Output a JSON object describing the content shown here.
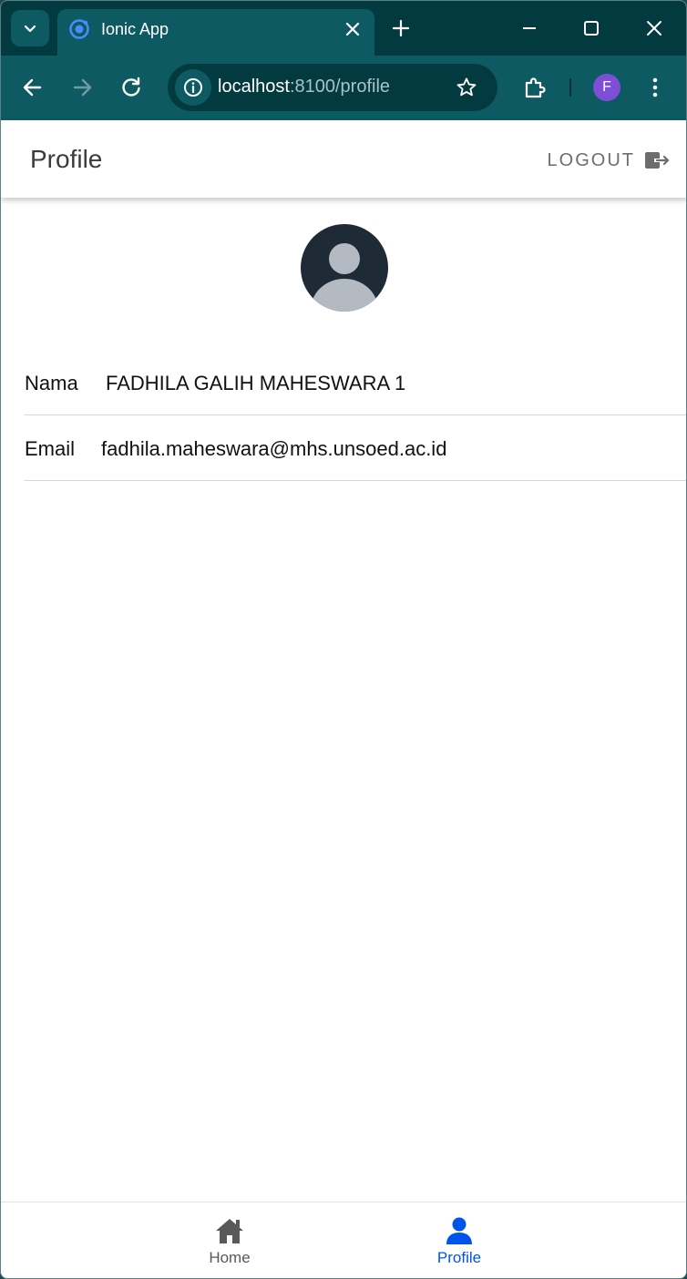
{
  "browser": {
    "tab_title": "Ionic App",
    "url_host": "localhost",
    "url_rest": ":8100/profile",
    "profile_initial": "F",
    "colors": {
      "frame": "#033a40",
      "toolbar": "#0d5a63",
      "profile": "#7e4fd6"
    }
  },
  "header": {
    "title": "Profile",
    "logout_label": "LOGOUT"
  },
  "profile": {
    "fields": [
      {
        "label": "Nama",
        "value": "FADHILA GALIH MAHESWARA 1"
      },
      {
        "label": "Email",
        "value": "fadhila.maheswara@mhs.unsoed.ac.id"
      }
    ]
  },
  "tabs": [
    {
      "label": "Home",
      "icon": "home-icon",
      "selected": false
    },
    {
      "label": "Profile",
      "icon": "person-icon",
      "selected": true
    }
  ],
  "colors": {
    "accent": "#0054e9",
    "inactive": "#595959"
  }
}
